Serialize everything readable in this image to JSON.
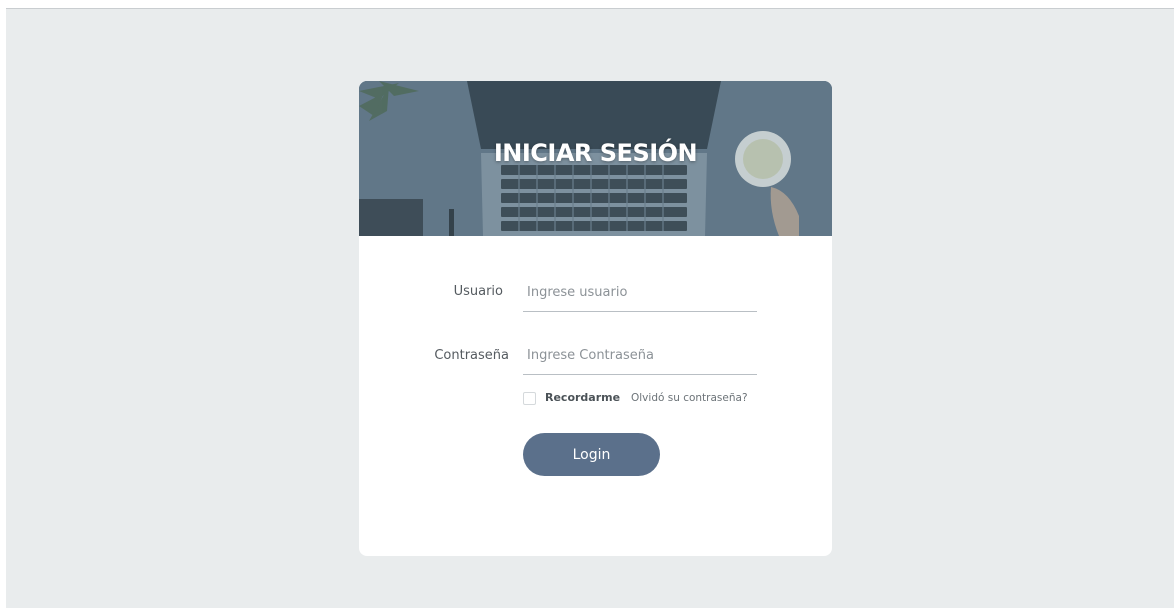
{
  "header": {
    "title": "INICIAR SESIÓN"
  },
  "form": {
    "username_label": "Usuario",
    "username_placeholder": "Ingrese usuario",
    "username_value": "",
    "password_label": "Contraseña",
    "password_placeholder": "Ingrese Contraseña",
    "password_value": "",
    "remember_label": "Recordarme",
    "remember_checked": false,
    "forgot_label": "Olvidó su contraseña?",
    "login_label": "Login"
  },
  "colors": {
    "page_background": "#e9eced",
    "card_background": "#ffffff",
    "banner_tint": "#5a6f80",
    "button": "#5b708b",
    "button_text": "#ffffff"
  },
  "icons": {
    "banner_image": "laptop-desk-photo"
  }
}
